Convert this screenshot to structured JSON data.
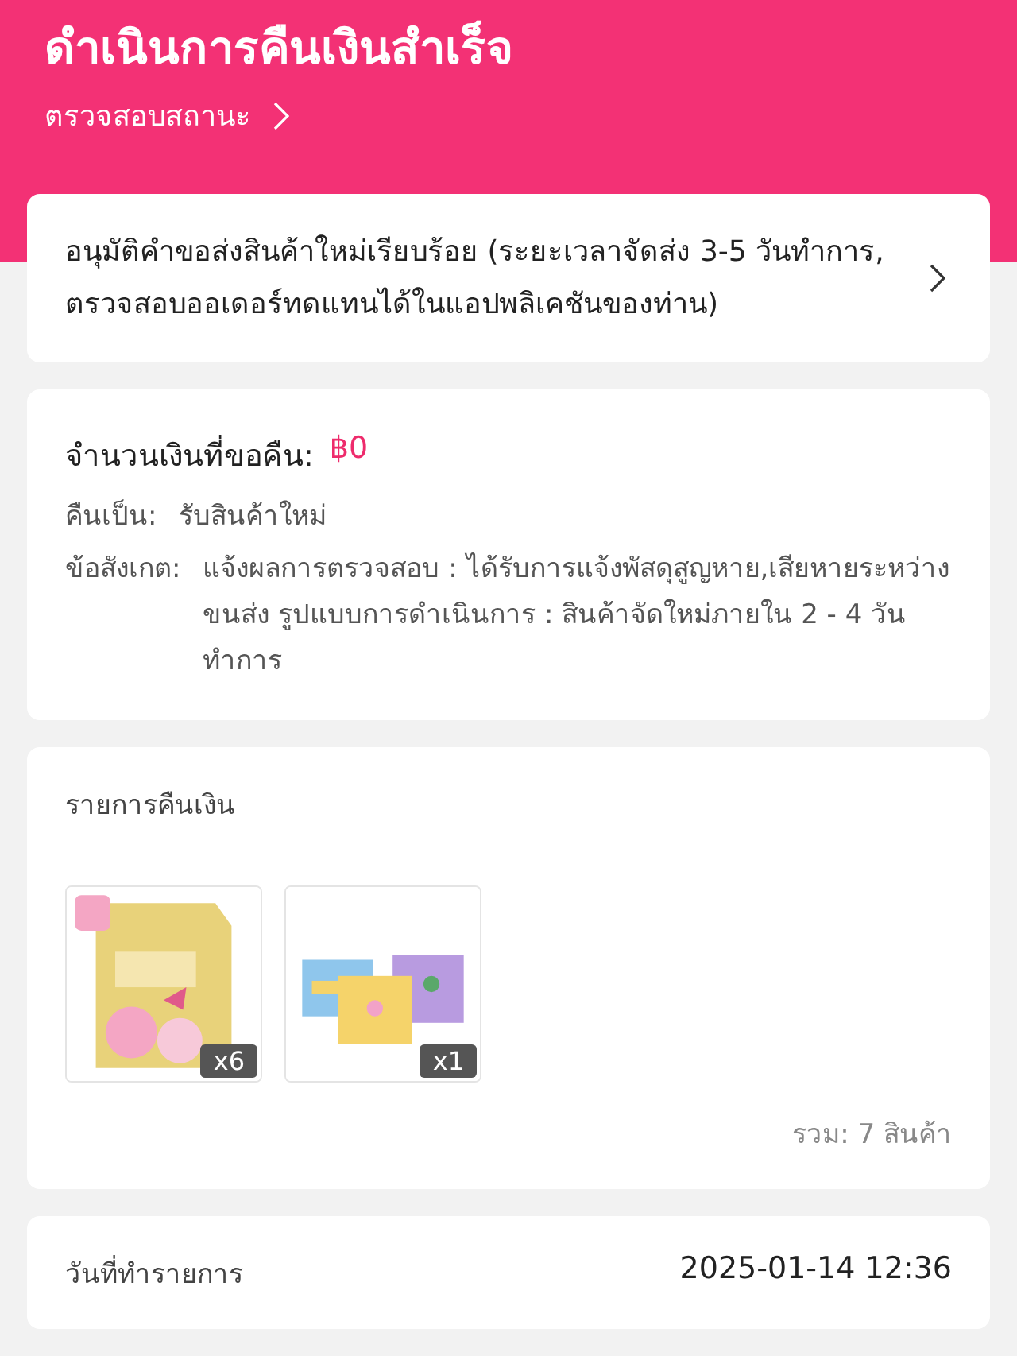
{
  "header": {
    "title": "ดำเนินการคืนเงินสำเร็จ",
    "status_link": "ตรวจสอบสถานะ"
  },
  "notice": {
    "text": "อนุมัติคำขอส่งสินค้าใหม่เรียบร้อย (ระยะเวลาจัดส่ง 3-5 วันทำการ, ตรวจสอบออเดอร์ทดแทนได้ในแอปพลิเคชันของท่าน)"
  },
  "refund": {
    "amount_label": "จำนวนเงินที่ขอคืน:",
    "amount": "฿0",
    "rows": [
      {
        "label": "คืนเป็น:",
        "value": "รับสินค้าใหม่"
      },
      {
        "label": "ข้อสังเกต:",
        "value": "แจ้งผลการตรวจสอบ : ได้รับการแจ้งพัสดุสูญหาย,เสียหายระหว่างขนส่ง รูปแบบการดำเนินการ : สินค้าจัดใหม่ภายใน 2 - 4 วันทำการ"
      }
    ]
  },
  "items": {
    "title": "รายการคืนเงิน",
    "products": [
      {
        "kind": "picture",
        "quantity": "x6"
      },
      {
        "kind": "picture",
        "quantity": "x1"
      }
    ],
    "total": "รวม: 7 สินค้า"
  },
  "details": [
    {
      "label": "วันที่ทำรายการ",
      "value": "2025-01-14 12:36"
    }
  ]
}
